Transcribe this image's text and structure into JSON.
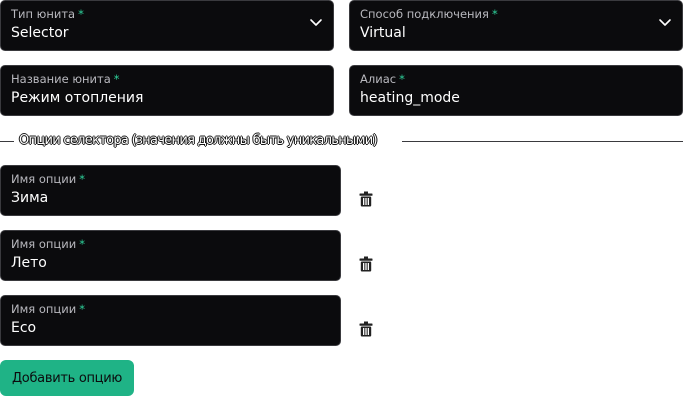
{
  "unit_type": {
    "label": "Тип юнита",
    "required": "*",
    "value": "Selector"
  },
  "connection": {
    "label": "Способ подключения",
    "required": "*",
    "value": "Virtual"
  },
  "unit_name": {
    "label": "Название юнита",
    "required": "*",
    "value": "Режим отопления"
  },
  "alias": {
    "label": "Алиас",
    "required": "*",
    "value": "heating_mode"
  },
  "options_section": {
    "title": "Опции селектора (значения должны быть уникальными)"
  },
  "options": [
    {
      "label": "Имя опции",
      "required": "*",
      "value": "Зима"
    },
    {
      "label": "Имя опции",
      "required": "*",
      "value": "Лето"
    },
    {
      "label": "Имя опции",
      "required": "*",
      "value": "Eco"
    }
  ],
  "add_option_label": "Добавить опцию",
  "icons": {
    "dropdown": "chevron-down-icon",
    "delete": "trash-icon"
  },
  "colors": {
    "field_bg": "#0b0b0d",
    "accent": "#1fb386",
    "required_mark": "#2fd39c"
  }
}
